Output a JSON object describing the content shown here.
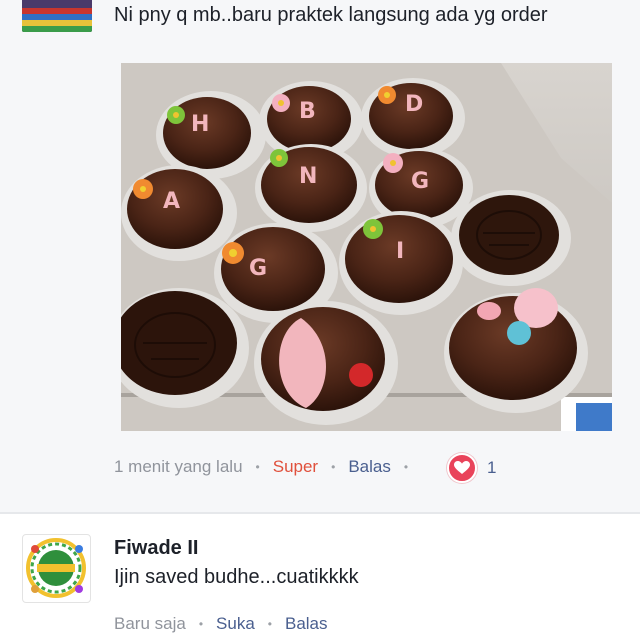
{
  "comment1": {
    "text": "Ni pny q mb..baru praktek langsung ada yg order",
    "timestamp": "1 menit yang lalu",
    "reaction_label": "Super",
    "reply_label": "Balas",
    "reaction_icon": "heart-icon",
    "reaction_count": "1"
  },
  "comment2": {
    "author": "Fiwade II",
    "text": "Ijin saved budhe...cuatikkkk",
    "timestamp": "Baru saja",
    "like_label": "Suka",
    "reply_label": "Balas"
  },
  "photo": {
    "cake_letters": [
      "H",
      "B",
      "D",
      "A",
      "N",
      "G",
      "G",
      "I"
    ]
  },
  "colors": {
    "text_primary": "#1d2129",
    "text_meta": "#90949c",
    "link": "#4a5f8f",
    "super": "#e0503c",
    "heart": "#e9435a"
  },
  "separator": "•"
}
